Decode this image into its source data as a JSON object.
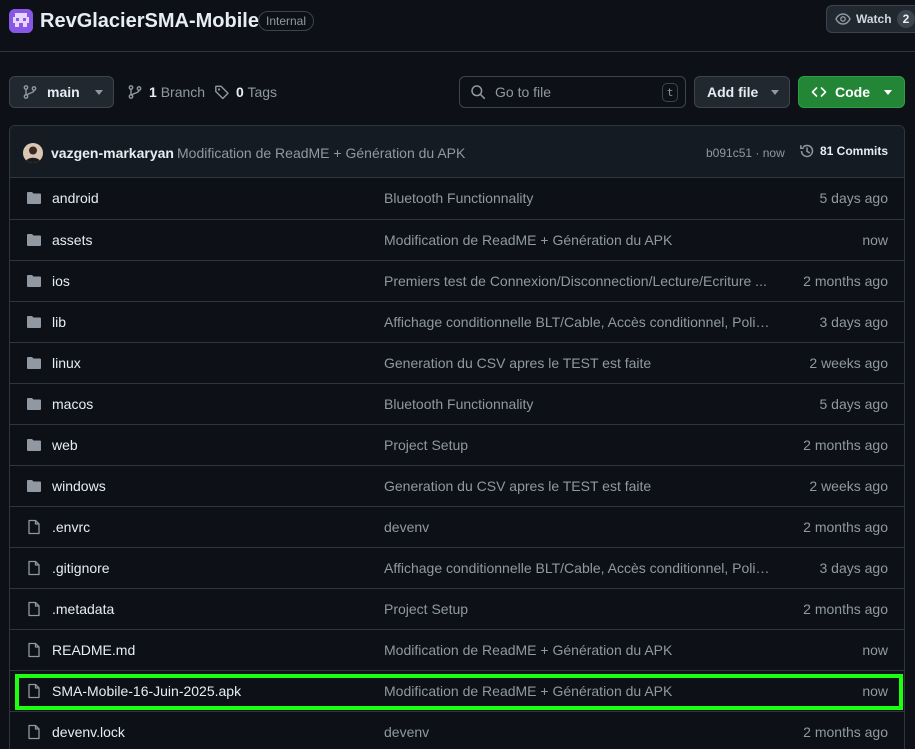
{
  "repo": {
    "name": "RevGlacierSMA-Mobile",
    "visibility": "Internal",
    "watch_label": "Watch",
    "watch_count": "2"
  },
  "toolbar": {
    "branch": "main",
    "branch_count": "1",
    "branch_label": "Branch",
    "tag_count": "0",
    "tag_label": "Tags",
    "search_placeholder": "Go to file",
    "search_shortcut": "t",
    "add_file_label": "Add file",
    "code_label": "Code"
  },
  "latest_commit": {
    "author": "vazgen-markaryan",
    "message": "Modification de ReadME + Génération du APK",
    "sha": "b091c51",
    "time": "now",
    "commits_count": "81 Commits"
  },
  "files": [
    {
      "name": "android",
      "type": "folder",
      "commit": "Bluetooth Functionnality",
      "age": "5 days ago"
    },
    {
      "name": "assets",
      "type": "folder",
      "commit": "Modification de ReadME + Génération du APK",
      "age": "now"
    },
    {
      "name": "ios",
      "type": "folder",
      "commit": "Premiers test de Connexion/Disconnection/Lecture/Ecriture ...",
      "age": "2 months ago"
    },
    {
      "name": "lib",
      "type": "folder",
      "commit": "Affichage conditionnelle BLT/Cable, Accès conditionnel, Polis...",
      "age": "3 days ago"
    },
    {
      "name": "linux",
      "type": "folder",
      "commit": "Generation du CSV apres le TEST est faite",
      "age": "2 weeks ago"
    },
    {
      "name": "macos",
      "type": "folder",
      "commit": "Bluetooth Functionnality",
      "age": "5 days ago"
    },
    {
      "name": "web",
      "type": "folder",
      "commit": "Project Setup",
      "age": "2 months ago"
    },
    {
      "name": "windows",
      "type": "folder",
      "commit": "Generation du CSV apres le TEST est faite",
      "age": "2 weeks ago"
    },
    {
      "name": ".envrc",
      "type": "file",
      "commit": "devenv",
      "age": "2 months ago"
    },
    {
      "name": ".gitignore",
      "type": "file",
      "commit": "Affichage conditionnelle BLT/Cable, Accès conditionnel, Polis...",
      "age": "3 days ago"
    },
    {
      "name": ".metadata",
      "type": "file",
      "commit": "Project Setup",
      "age": "2 months ago"
    },
    {
      "name": "README.md",
      "type": "file",
      "commit": "Modification de ReadME + Génération du APK",
      "age": "now"
    },
    {
      "name": "SMA-Mobile-16-Juin-2025.apk",
      "type": "file",
      "commit": "Modification de ReadME + Génération du APK",
      "age": "now"
    },
    {
      "name": "devenv.lock",
      "type": "file",
      "commit": "devenv",
      "age": "2 months ago"
    }
  ],
  "colors": {
    "background": "#0d1117",
    "border": "#30363d",
    "code_button": "#238636",
    "highlight": "#1cff0f",
    "folder_icon": "#9198a1"
  }
}
